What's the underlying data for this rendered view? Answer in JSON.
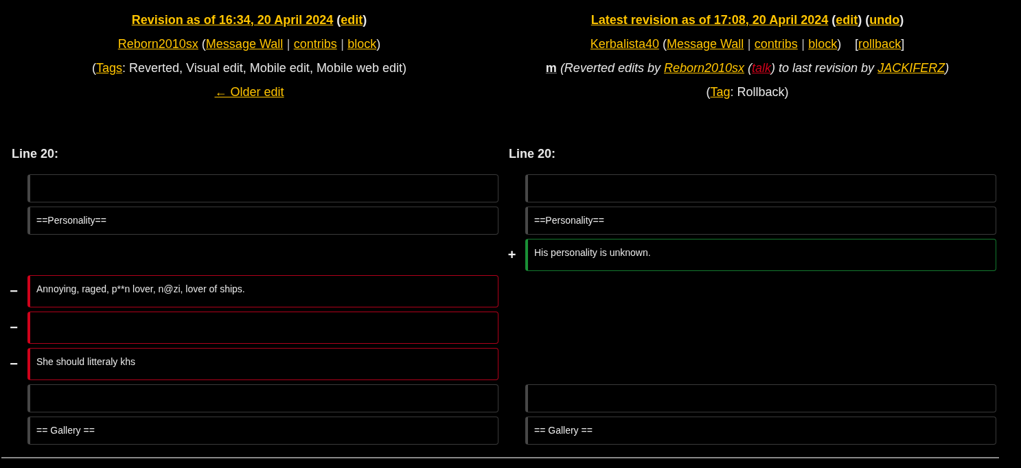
{
  "left": {
    "lines": [
      {
        "kind": "title",
        "parts": [
          {
            "kind": "link",
            "text": "Revision as of 16:34, 20 April 2024"
          },
          {
            "kind": "text",
            "text": " ("
          },
          {
            "kind": "link",
            "text": "edit"
          },
          {
            "kind": "text",
            "text": ")"
          }
        ]
      },
      {
        "kind": "user",
        "parts": [
          {
            "kind": "link",
            "text": "Reborn2010sx"
          },
          {
            "kind": "text",
            "text": " ("
          },
          {
            "kind": "link",
            "text": "Message Wall"
          },
          {
            "kind": "sep",
            "text": "|"
          },
          {
            "kind": "link",
            "text": "contribs"
          },
          {
            "kind": "sep",
            "text": "|"
          },
          {
            "kind": "link",
            "text": "block"
          },
          {
            "kind": "text",
            "text": ")"
          }
        ]
      },
      {
        "kind": "tags",
        "parts": [
          {
            "kind": "text",
            "text": "("
          },
          {
            "kind": "link",
            "text": "Tags"
          },
          {
            "kind": "text",
            "text": ": Reverted, Visual edit, Mobile edit, Mobile web edit)"
          }
        ]
      },
      {
        "kind": "nav",
        "parts": [
          {
            "kind": "link",
            "text": "← Older edit"
          }
        ]
      }
    ],
    "line_label": "Line 20:"
  },
  "right": {
    "lines": [
      {
        "kind": "title",
        "parts": [
          {
            "kind": "link",
            "text": "Latest revision as of 17:08, 20 April 2024"
          },
          {
            "kind": "text",
            "text": " ("
          },
          {
            "kind": "link",
            "text": "edit"
          },
          {
            "kind": "text",
            "text": ") ("
          },
          {
            "kind": "link",
            "text": "undo"
          },
          {
            "kind": "text",
            "text": ")"
          }
        ]
      },
      {
        "kind": "user",
        "parts": [
          {
            "kind": "link",
            "text": "Kerbalista40"
          },
          {
            "kind": "text",
            "text": " ("
          },
          {
            "kind": "link",
            "text": "Message Wall"
          },
          {
            "kind": "sep",
            "text": "|"
          },
          {
            "kind": "link",
            "text": "contribs"
          },
          {
            "kind": "sep",
            "text": "|"
          },
          {
            "kind": "link",
            "text": "block"
          },
          {
            "kind": "text",
            "text": ")"
          },
          {
            "kind": "text_spaced",
            "text": "["
          },
          {
            "kind": "link",
            "text": "rollback"
          },
          {
            "kind": "text",
            "text": "]"
          }
        ]
      },
      {
        "kind": "summary",
        "parts": [
          {
            "kind": "minor",
            "text": "m"
          },
          {
            "kind": "text",
            "text": " (Reverted edits by "
          },
          {
            "kind": "link",
            "text": "Reborn2010sx"
          },
          {
            "kind": "text",
            "text": " ("
          },
          {
            "kind": "redlink",
            "text": "talk"
          },
          {
            "kind": "text",
            "text": ") to last revision by "
          },
          {
            "kind": "link",
            "text": "JACKIFERZ"
          },
          {
            "kind": "text",
            "text": ")"
          }
        ]
      },
      {
        "kind": "tags",
        "parts": [
          {
            "kind": "text",
            "text": "("
          },
          {
            "kind": "link",
            "text": "Tag"
          },
          {
            "kind": "text",
            "text": ": Rollback)"
          }
        ]
      }
    ],
    "line_label": "Line 20:"
  },
  "rows": [
    {
      "left": {
        "kind": "context"
      },
      "right": {
        "kind": "context"
      }
    },
    {
      "left": {
        "kind": "context",
        "text": "==Personality=="
      },
      "right": {
        "kind": "context",
        "text": "==Personality=="
      }
    },
    {
      "left": {
        "kind": "blank"
      },
      "right": {
        "kind": "added",
        "marker": "+",
        "text": "His personality is unknown."
      }
    },
    {
      "left": {
        "kind": "deleted",
        "marker": "−",
        "text": "Annoying, raged, p**n lover, n@zi, lover of ships."
      },
      "right": {
        "kind": "blank"
      }
    },
    {
      "left": {
        "kind": "deleted",
        "marker": "−"
      },
      "right": {
        "kind": "blank"
      }
    },
    {
      "left": {
        "kind": "deleted",
        "marker": "−",
        "text": "She should litteraly khs"
      },
      "right": {
        "kind": "blank"
      }
    },
    {
      "left": {
        "kind": "context"
      },
      "right": {
        "kind": "context"
      }
    },
    {
      "left": {
        "kind": "context",
        "text": "== Gallery =="
      },
      "right": {
        "kind": "context",
        "text": "== Gallery =="
      }
    }
  ]
}
